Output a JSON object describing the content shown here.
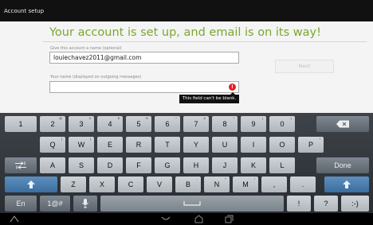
{
  "titlebar": {
    "title": "Account setup"
  },
  "main": {
    "headline": "Your account is set up, and email is on its way!",
    "account_name_label": "Give this account a name (optional)",
    "account_name_value": "louiechavez2011@gmail.com",
    "your_name_label": "Your name (displayed on outgoing messages)",
    "your_name_value": "",
    "next_label": "Next",
    "error_tooltip": "This field can't be blank."
  },
  "keyboard": {
    "row1": [
      {
        "label": "1",
        "hint": ""
      },
      {
        "label": "2",
        "hint": "@"
      },
      {
        "label": "3",
        "hint": "#"
      },
      {
        "label": "4",
        "hint": "$"
      },
      {
        "label": "5",
        "hint": "%"
      },
      {
        "label": "6",
        "hint": "^"
      },
      {
        "label": "7",
        "hint": "&"
      },
      {
        "label": "8",
        "hint": "*"
      },
      {
        "label": "9",
        "hint": "("
      },
      {
        "label": "0",
        "hint": ")"
      }
    ],
    "row2": [
      {
        "label": "Q",
        "hint": "["
      },
      {
        "label": "W",
        "hint": "]"
      },
      {
        "label": "E",
        "hint": ""
      },
      {
        "label": "R",
        "hint": ""
      },
      {
        "label": "T",
        "hint": ""
      },
      {
        "label": "Y",
        "hint": ""
      },
      {
        "label": "U",
        "hint": ""
      },
      {
        "label": "I",
        "hint": ""
      },
      {
        "label": "O",
        "hint": ""
      },
      {
        "label": "P",
        "hint": "*"
      }
    ],
    "row3": [
      {
        "label": "A",
        "hint": ""
      },
      {
        "label": "S",
        "hint": ""
      },
      {
        "label": "D",
        "hint": ""
      },
      {
        "label": "F",
        "hint": ""
      },
      {
        "label": "G",
        "hint": ""
      },
      {
        "label": "H",
        "hint": "-"
      },
      {
        "label": "J",
        "hint": ";"
      },
      {
        "label": "K",
        "hint": ":"
      },
      {
        "label": "L",
        "hint": "'"
      }
    ],
    "row4": [
      {
        "label": "Z",
        "hint": ""
      },
      {
        "label": "X",
        "hint": ""
      },
      {
        "label": "C",
        "hint": ""
      },
      {
        "label": "V",
        "hint": ""
      },
      {
        "label": "B",
        "hint": "-"
      },
      {
        "label": "N",
        "hint": "?"
      },
      {
        "label": "M",
        "hint": "/"
      },
      {
        "label": ",",
        "hint": ""
      },
      {
        "label": ".",
        "hint": ""
      }
    ],
    "done_label": "Done",
    "lang_label": "En",
    "symbols_label": "1@#",
    "exclaim_label": "!",
    "question_label": "?",
    "smiley_label": ":-)",
    "icons": {
      "backspace": "backspace-icon",
      "tab": "tab-icon",
      "shift": "shift-icon",
      "mic": "microphone-icon",
      "space": "space-bar-icon"
    }
  },
  "navbar": {
    "icons": [
      "back-icon",
      "home-icon",
      "recent-apps-icon",
      "keyboard-hide-icon"
    ]
  },
  "colors": {
    "accent_green": "#7aa72d",
    "error_red": "#e02020",
    "key_blue": "#3b6e9e"
  }
}
